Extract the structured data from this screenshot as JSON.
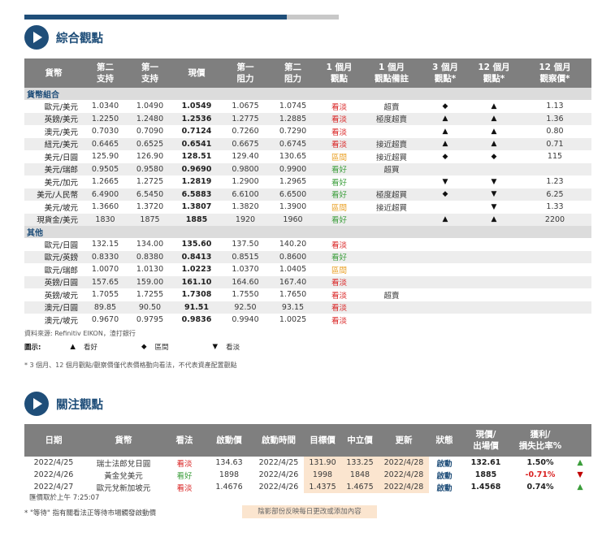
{
  "topbar_progress": 0.835,
  "section1": {
    "title": "綜合觀點",
    "headers": [
      "貨幣",
      "第二\n支持",
      "第一\n支持",
      "現價",
      "第一\n阻力",
      "第二\n阻力",
      "1 個月\n觀點",
      "1 個月\n觀點備註",
      "3 個月\n觀點*",
      "12 個月\n觀點*",
      "12 個月\n觀察價*"
    ],
    "group1": "貨幣組合",
    "group2": "其他",
    "rows1": [
      {
        "pair": "歐元/美元",
        "s2": "1.0340",
        "s1": "1.0490",
        "px": "1.0549",
        "r1": "1.0675",
        "r2": "1.0745",
        "v1": "看淡",
        "cls": "bear",
        "note": "超賣",
        "m3": "◆",
        "m12": "▲",
        "target": "1.13"
      },
      {
        "pair": "英鎊/美元",
        "s2": "1.2250",
        "s1": "1.2480",
        "px": "1.2536",
        "r1": "1.2775",
        "r2": "1.2885",
        "v1": "看淡",
        "cls": "bear",
        "note": "極度超賣",
        "m3": "▲",
        "m12": "▲",
        "target": "1.36"
      },
      {
        "pair": "澳元/美元",
        "s2": "0.7030",
        "s1": "0.7090",
        "px": "0.7124",
        "r1": "0.7260",
        "r2": "0.7290",
        "v1": "看淡",
        "cls": "bear",
        "note": "",
        "m3": "▲",
        "m12": "▲",
        "target": "0.80"
      },
      {
        "pair": "紐元/美元",
        "s2": "0.6465",
        "s1": "0.6525",
        "px": "0.6541",
        "r1": "0.6675",
        "r2": "0.6745",
        "v1": "看淡",
        "cls": "bear",
        "note": "接近超賣",
        "m3": "▲",
        "m12": "▲",
        "target": "0.71"
      },
      {
        "pair": "美元/日圓",
        "s2": "125.90",
        "s1": "126.90",
        "px": "128.51",
        "r1": "129.40",
        "r2": "130.65",
        "v1": "區間",
        "cls": "neut",
        "note": "接近超買",
        "m3": "◆",
        "m12": "◆",
        "target": "115"
      },
      {
        "pair": "美元/瑞郎",
        "s2": "0.9505",
        "s1": "0.9580",
        "px": "0.9690",
        "r1": "0.9800",
        "r2": "0.9900",
        "v1": "看好",
        "cls": "bull",
        "note": "超買",
        "m3": "",
        "m12": "",
        "target": ""
      },
      {
        "pair": "美元/加元",
        "s2": "1.2665",
        "s1": "1.2725",
        "px": "1.2819",
        "r1": "1.2900",
        "r2": "1.2965",
        "v1": "看好",
        "cls": "bull",
        "note": "",
        "m3": "▼",
        "m12": "▼",
        "target": "1.23"
      },
      {
        "pair": "美元/人民幣",
        "s2": "6.4900",
        "s1": "6.5450",
        "px": "6.5883",
        "r1": "6.6100",
        "r2": "6.6500",
        "v1": "看好",
        "cls": "bull",
        "note": "極度超買",
        "m3": "◆",
        "m12": "▼",
        "target": "6.25"
      },
      {
        "pair": "美元/坡元",
        "s2": "1.3660",
        "s1": "1.3720",
        "px": "1.3807",
        "r1": "1.3820",
        "r2": "1.3900",
        "v1": "區間",
        "cls": "neut",
        "note": "接近超買",
        "m3": "",
        "m12": "▼",
        "target": "1.33"
      },
      {
        "pair": "現貨金/美元",
        "s2": "1830",
        "s1": "1875",
        "px": "1885",
        "r1": "1920",
        "r2": "1960",
        "v1": "看好",
        "cls": "bull",
        "note": "",
        "m3": "▲",
        "m12": "▲",
        "target": "2200"
      }
    ],
    "rows2": [
      {
        "pair": "歐元/日圓",
        "s2": "132.15",
        "s1": "134.00",
        "px": "135.60",
        "r1": "137.50",
        "r2": "140.20",
        "v1": "看淡",
        "cls": "bear",
        "note": ""
      },
      {
        "pair": "歐元/英鎊",
        "s2": "0.8330",
        "s1": "0.8380",
        "px": "0.8413",
        "r1": "0.8515",
        "r2": "0.8600",
        "v1": "看好",
        "cls": "bull",
        "note": ""
      },
      {
        "pair": "歐元/瑞郎",
        "s2": "1.0070",
        "s1": "1.0130",
        "px": "1.0223",
        "r1": "1.0370",
        "r2": "1.0405",
        "v1": "區間",
        "cls": "neut",
        "note": ""
      },
      {
        "pair": "英鎊/日圓",
        "s2": "157.65",
        "s1": "159.00",
        "px": "161.10",
        "r1": "164.60",
        "r2": "167.40",
        "v1": "看淡",
        "cls": "bear",
        "note": ""
      },
      {
        "pair": "英鎊/坡元",
        "s2": "1.7055",
        "s1": "1.7255",
        "px": "1.7308",
        "r1": "1.7550",
        "r2": "1.7650",
        "v1": "看淡",
        "cls": "bear",
        "note": "超賣"
      },
      {
        "pair": "澳元/日圓",
        "s2": "89.85",
        "s1": "90.50",
        "px": "91.51",
        "r1": "92.50",
        "r2": "93.15",
        "v1": "看淡",
        "cls": "bear",
        "note": ""
      },
      {
        "pair": "澳元/坡元",
        "s2": "0.9670",
        "s1": "0.9795",
        "px": "0.9836",
        "r1": "0.9940",
        "r2": "1.0025",
        "v1": "看淡",
        "cls": "bear",
        "note": ""
      }
    ],
    "source": "資料來源: Refinitiv EIKON，渣打銀行",
    "legend": {
      "label": "圖示:",
      "items": [
        {
          "sym": "▲",
          "text": "看好"
        },
        {
          "sym": "◆",
          "text": "區間"
        },
        {
          "sym": "▼",
          "text": "看淡"
        }
      ]
    },
    "footnote": "* 3 個月、12 個月觀點/觀察價僅代表價格動向看法，不代表資產配置觀點"
  },
  "section2": {
    "title": "關注觀點",
    "headers": [
      "日期",
      "貨幣",
      "看法",
      "啟動價",
      "啟動時間",
      "目標價",
      "中立價",
      "更新",
      "狀態",
      "現價/\n出場價",
      "獲利/\n損失比率%",
      ""
    ],
    "rows": [
      {
        "date": "2022/4/25",
        "pair": "瑞士法郎兌日圓",
        "view": "看淡",
        "cls": "bear",
        "entry": "134.63",
        "etime": "2022/4/25",
        "target": "131.90",
        "neutral": "133.25",
        "update": "2022/4/28",
        "status": "啟動",
        "price": "132.61",
        "pl": "1.50%",
        "plcls": "pos",
        "arrow": "▲",
        "acls": "up"
      },
      {
        "date": "2022/4/26",
        "pair": "黃金兌美元",
        "view": "看好",
        "cls": "bull",
        "entry": "1898",
        "etime": "2022/4/26",
        "target": "1998",
        "neutral": "1848",
        "update": "2022/4/28",
        "status": "啟動",
        "price": "1885",
        "pl": "-0.71%",
        "plcls": "neg",
        "arrow": "▼",
        "acls": "down"
      },
      {
        "date": "2022/4/27",
        "pair": "歐元兌新加坡元",
        "view": "看淡",
        "cls": "bear",
        "entry": "1.4676",
        "etime": "2022/4/26",
        "target": "1.4375",
        "neutral": "1.4675",
        "update": "2022/4/28",
        "status": "啟動",
        "price": "1.4568",
        "pl": "0.74%",
        "plcls": "pos",
        "arrow": "▲",
        "acls": "up"
      }
    ],
    "rate_time": "匯價取於上午 7:25:07",
    "wait_note": "* \"等待\" 指有關看法正等待市場觸發啟動價",
    "shade_note": "陰影部份反映每日更改或添加內容"
  }
}
